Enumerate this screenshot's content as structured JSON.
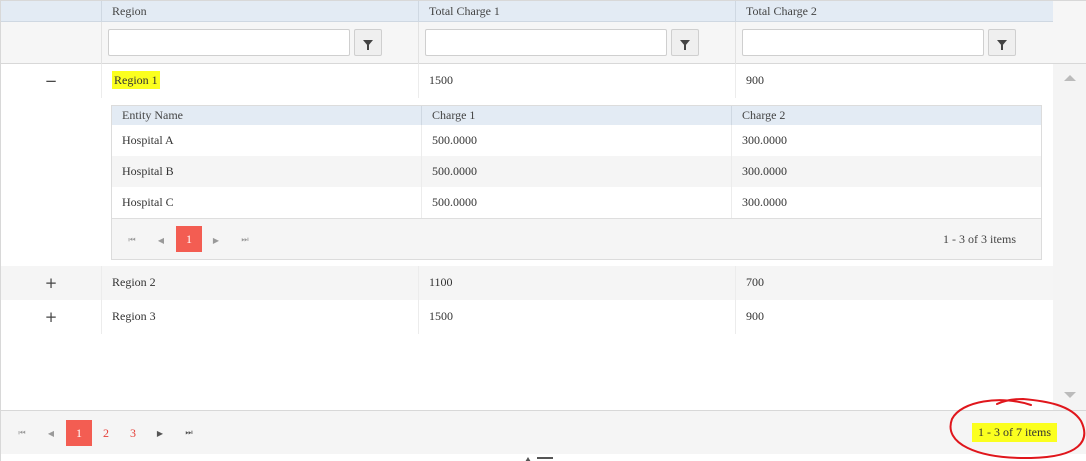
{
  "columns": [
    "Region",
    "Total Charge 1",
    "Total Charge 2"
  ],
  "rows": [
    {
      "toggle": "−",
      "region": "Region 1",
      "charge1": "1500",
      "charge2": "900",
      "expanded": true
    },
    {
      "toggle": "+",
      "region": "Region 2",
      "charge1": "1100",
      "charge2": "700",
      "expanded": false
    },
    {
      "toggle": "+",
      "region": "Region 3",
      "charge1": "1500",
      "charge2": "900",
      "expanded": false
    }
  ],
  "detail": {
    "columns": [
      "Entity Name",
      "Charge 1",
      "Charge 2"
    ],
    "rows": [
      {
        "name": "Hospital A",
        "charge1": "500.0000",
        "charge2": "300.0000"
      },
      {
        "name": "Hospital B",
        "charge1": "500.0000",
        "charge2": "300.0000"
      },
      {
        "name": "Hospital C",
        "charge1": "500.0000",
        "charge2": "300.0000"
      }
    ],
    "pager": {
      "current_page": "1",
      "info": "1 - 3 of 3 items"
    }
  },
  "pager": {
    "pages": [
      "1",
      "2",
      "3"
    ],
    "current_page": "1",
    "info": "1 - 3 of 7 items"
  },
  "icons": {
    "first": "first-page-icon",
    "prev": "previous-page-icon",
    "next": "next-page-icon",
    "last": "last-page-icon",
    "filter": "filter-icon"
  },
  "colors": {
    "header_bg": "#e3ebf4",
    "current_page_bg": "#f35d52",
    "page_link": "#e5413a",
    "highlight": "#fbff1f",
    "annotation_circle": "#e0161c"
  }
}
